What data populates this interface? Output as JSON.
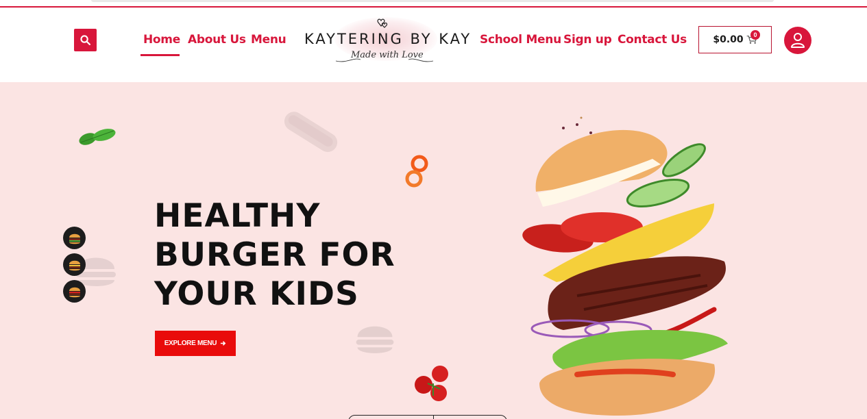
{
  "header": {
    "nav_left": [
      {
        "label": "Home",
        "active": true
      },
      {
        "label": "About Us"
      },
      {
        "label": "Menu"
      }
    ],
    "nav_right": [
      {
        "label": "School Menu"
      },
      {
        "label": "Sign up"
      },
      {
        "label": "Contact Us"
      }
    ],
    "logo": {
      "title": "KAYTERING BY KAY",
      "tagline": "Made with Love"
    },
    "cart": {
      "amount": "$0.00",
      "count": "0"
    }
  },
  "hero": {
    "title_lines": [
      "HEALTHY",
      "BURGER FOR",
      "YOUR KIDS"
    ],
    "cta_label": "EXPLORE MENU"
  },
  "icons": {
    "search": "search-icon",
    "cart": "cart-icon",
    "user": "user-icon",
    "arrow": "arrow-right-icon"
  },
  "colors": {
    "brand": "#d8163b",
    "cta": "#e90b0b",
    "hero_bg": "#fbe4e3",
    "text_dark": "#111111"
  }
}
